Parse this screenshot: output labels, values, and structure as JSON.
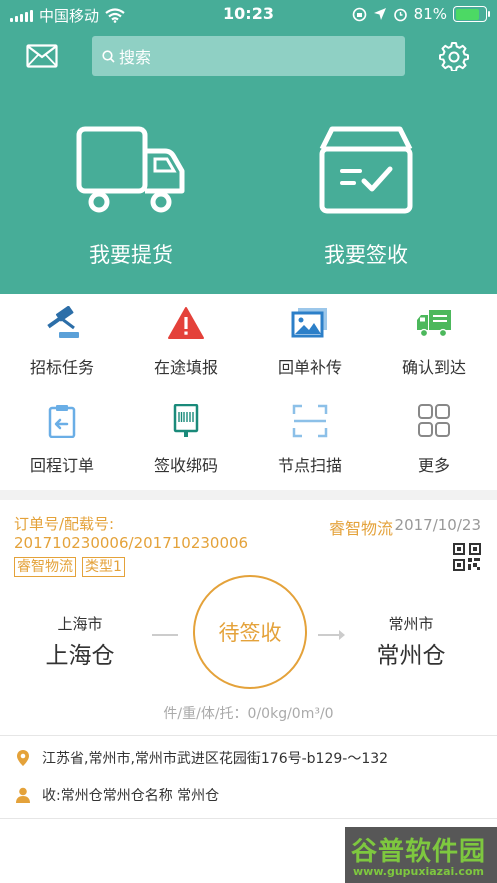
{
  "status_bar": {
    "carrier": "中国移动",
    "time": "10:23",
    "battery": "81%",
    "battery_level": 0.81
  },
  "topbar": {
    "search_placeholder": "搜索"
  },
  "actions": [
    {
      "label": "我要提货",
      "icon": "truck-icon"
    },
    {
      "label": "我要签收",
      "icon": "box-check-icon"
    }
  ],
  "grid": [
    {
      "label": "招标任务",
      "icon": "gavel-icon"
    },
    {
      "label": "在途填报",
      "icon": "warning-icon"
    },
    {
      "label": "回单补传",
      "icon": "image-stack-icon"
    },
    {
      "label": "确认到达",
      "icon": "delivery-truck-icon"
    },
    {
      "label": "回程订单",
      "icon": "clipboard-return-icon"
    },
    {
      "label": "签收绑码",
      "icon": "barcode-icon"
    },
    {
      "label": "节点扫描",
      "icon": "scan-frame-icon"
    },
    {
      "label": "更多",
      "icon": "more-grid-icon"
    }
  ],
  "order": {
    "order_label": "订单号/配载号:",
    "order_number": "201710230006/201710230006",
    "company": "睿智物流",
    "date": "2017/10/23",
    "tags": [
      "睿智物流",
      "类型1"
    ],
    "from_city": "上海市",
    "from_warehouse": "上海仓",
    "to_city": "常州市",
    "to_warehouse": "常州仓",
    "status": "待签收",
    "weight": "件/重/体/托：0/0kg/0m³/0",
    "address": "江苏省,常州市,常州市武进区花园街176号-b129-～132",
    "receiver": "收:常州仓常州仓名称 常州仓"
  },
  "watermark": {
    "title": "谷普软件园",
    "url": "www.gupuxiazai.com"
  },
  "colors": {
    "primary": "#47ad98",
    "accent": "#e4a23a"
  }
}
